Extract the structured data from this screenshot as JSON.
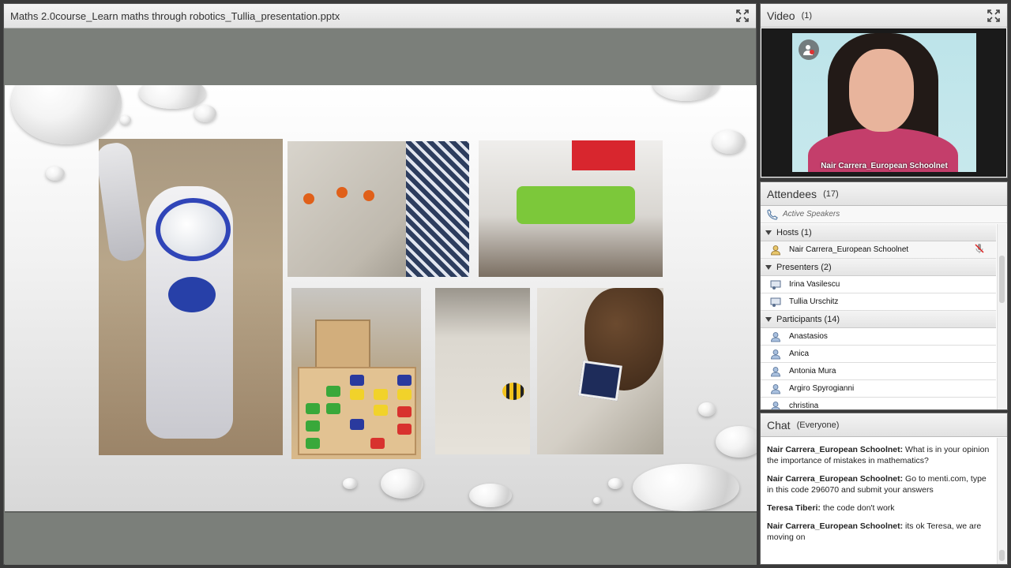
{
  "share": {
    "title": "Maths 2.0course_Learn maths through robotics_Tullia_presentation.pptx"
  },
  "video": {
    "title": "Video",
    "count": "(1)",
    "presenter_name": "Nair Carrera_European Schoolnet"
  },
  "attendees": {
    "title": "Attendees",
    "count": "(17)",
    "active_speakers": "Active Speakers",
    "hosts_label": "Hosts (1)",
    "hosts": [
      "Nair Carrera_European Schoolnet"
    ],
    "presenters_label": "Presenters (2)",
    "presenters": [
      "Irina Vasilescu",
      "Tullia Urschitz"
    ],
    "participants_label": "Participants (14)",
    "participants": [
      "Anastasios",
      "Anica",
      "Antonia Mura",
      "Argiro Spyrogianni",
      "christina"
    ]
  },
  "chat": {
    "title": "Chat",
    "scope": "(Everyone)",
    "messages": [
      {
        "who": "Nair Carrera_European Schoolnet:",
        "text": " What is in your opinion the importance of mistakes in mathematics?"
      },
      {
        "who": "Nair Carrera_European Schoolnet:",
        "text": " Go to menti.com, type in this code 296070 and submit your answers"
      },
      {
        "who": "Teresa Tiberi:",
        "text": " the code don't work"
      },
      {
        "who": "Nair Carrera_European Schoolnet:",
        "text": " its ok Teresa, we are moving on"
      }
    ]
  },
  "colors": {
    "pod_header": "#e2e2e2",
    "slide_bg": "#7b7f7a",
    "chat_text": "#222222"
  }
}
